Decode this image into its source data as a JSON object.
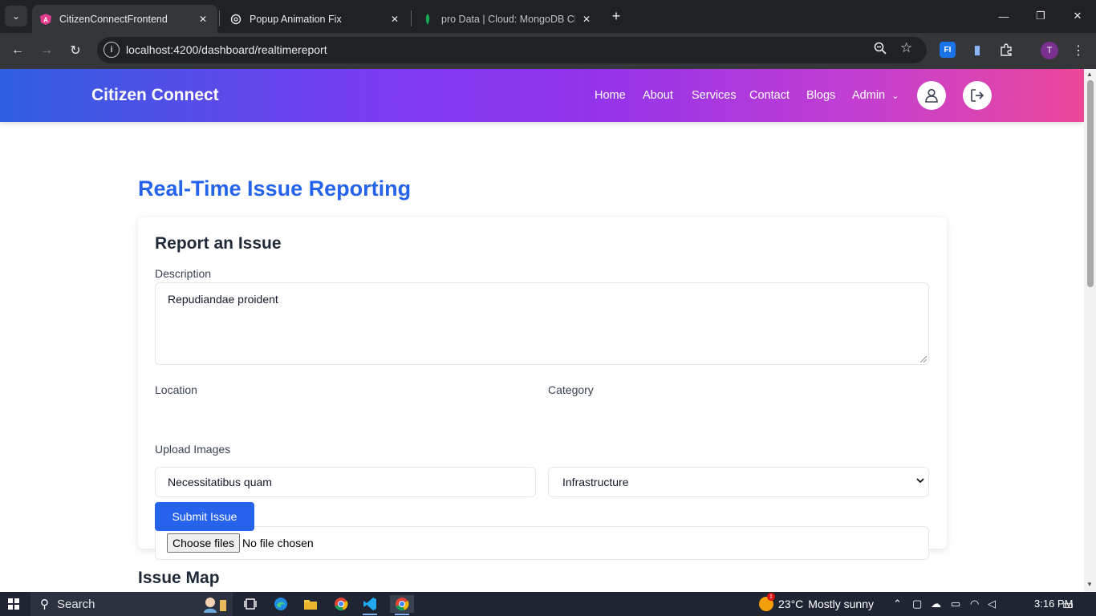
{
  "browser": {
    "tabs": [
      {
        "title": "CitizenConnectFrontend",
        "icon": "angular-icon",
        "active": true
      },
      {
        "title": "Popup Animation Fix",
        "icon": "openai-icon",
        "active": false
      },
      {
        "title": "pro Data | Cloud: MongoDB Clo",
        "icon": "mongodb-leaf-icon",
        "active": false
      }
    ],
    "url": "localhost:4200/dashboard/realtimereport",
    "profile_initial": "T",
    "extensions": [
      "fi-extension-icon",
      "document-extension-icon",
      "puzzle-icon"
    ]
  },
  "navbar": {
    "brand": "Citizen Connect",
    "links": [
      "Home",
      "About",
      "Services",
      "Contact",
      "Blogs"
    ],
    "admin_label": "Admin",
    "gradient": [
      "#2f5fe0",
      "#9333ea",
      "#ec4899"
    ]
  },
  "page": {
    "title": "Real-Time Issue Reporting",
    "form": {
      "heading": "Report an Issue",
      "description_label": "Description",
      "description_value": "Repudiandae proident",
      "location_label": "Location",
      "location_value": "Necessitatibus quam",
      "category_label": "Category",
      "category_value": "Infrastructure",
      "upload_label": "Upload Images",
      "choose_files": "Choose files",
      "no_file": "No file chosen",
      "submit": "Submit Issue"
    },
    "map_heading": "Issue Map",
    "accent": "#2563eb"
  },
  "taskbar": {
    "search": "Search",
    "weather_notifications": "1",
    "temperature": "23°C",
    "weather": "Mostly sunny",
    "time": "3:16 PM"
  }
}
